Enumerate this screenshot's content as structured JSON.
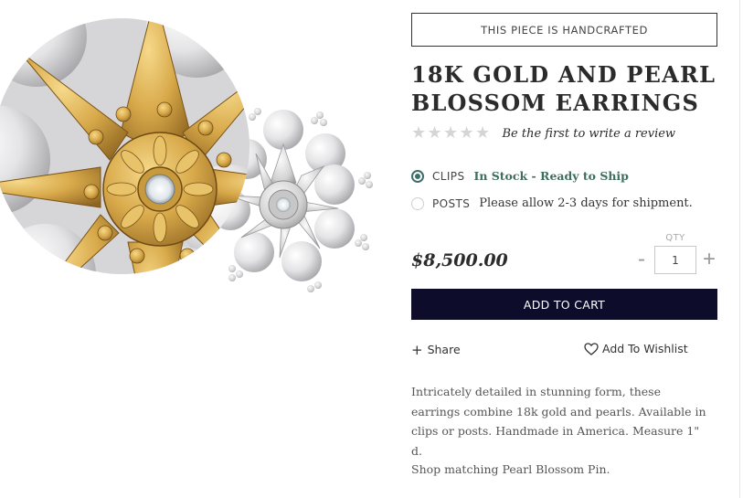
{
  "badge": {
    "text": "THIS PIECE IS HANDCRAFTED"
  },
  "product": {
    "title_line1": "18K GOLD AND PEARL",
    "title_line2": "BLOSSOM EARRINGS",
    "image_alt": "18K Gold and Pearl Blossom Earrings"
  },
  "rating": {
    "stars": 0,
    "max": 5,
    "review_link": "Be the first to write a review"
  },
  "options": [
    {
      "label": "CLIPS",
      "selected": true,
      "availability": "In Stock - Ready to Ship"
    },
    {
      "label": "POSTS",
      "selected": false,
      "availability": "Please allow 2-3 days for shipment."
    }
  ],
  "price": "$8,500.00",
  "quantity": {
    "label": "QTY",
    "value": "1",
    "minus": "-",
    "plus": "+"
  },
  "cart": {
    "button_label": "ADD TO CART",
    "color": "#0d0c2a"
  },
  "actions": {
    "share": "Share",
    "share_icon": "plus-icon",
    "wishlist": "Add To Wishlist",
    "wishlist_icon": "heart-icon"
  },
  "description": "Intricately detailed in stunning form, these earrings combine 18k gold and pearls. Available in clips or posts. Handmade in America. Measure 1\" d.",
  "shop_matching": "Shop matching Pearl Blossom Pin.",
  "colors": {
    "accent": "#3e6e6a",
    "stock": "#3e6e5e",
    "star_empty": "#d5d5d5"
  }
}
